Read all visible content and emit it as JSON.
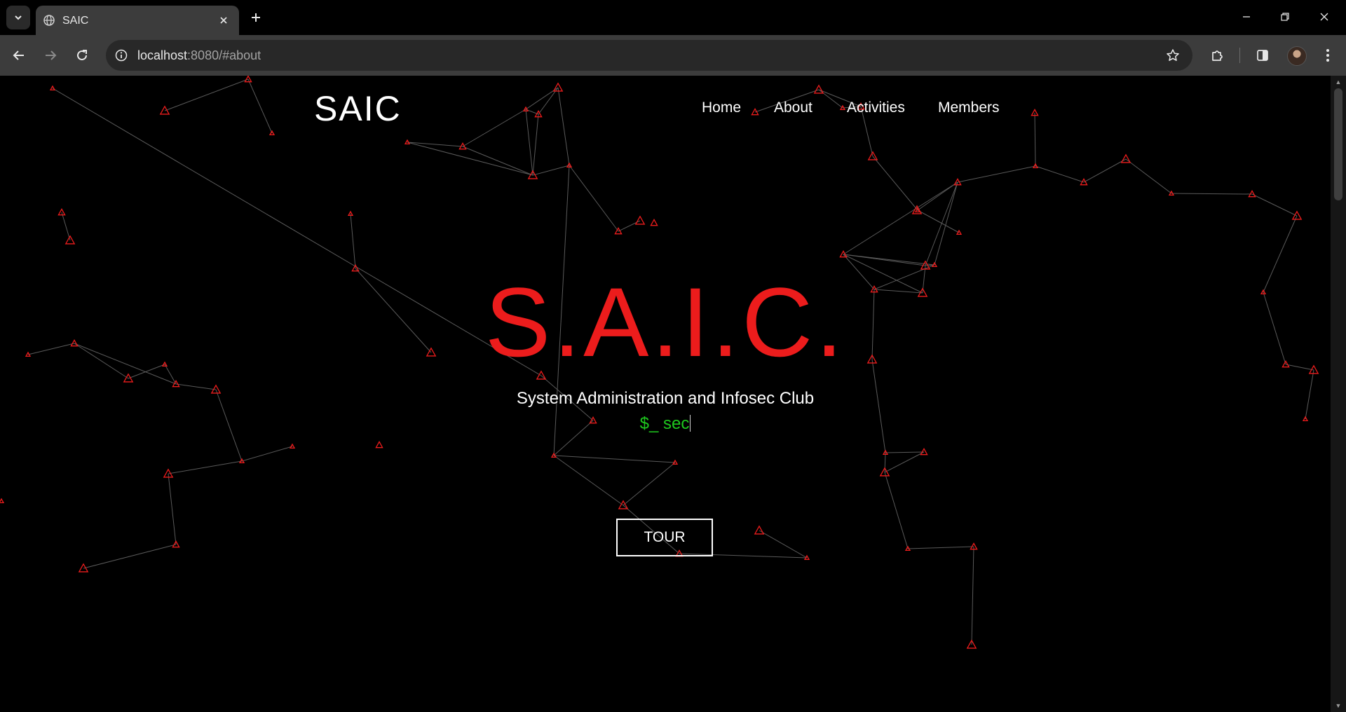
{
  "browser": {
    "tab_title": "SAIC",
    "url_host": "localhost",
    "url_rest": ":8080/#about"
  },
  "site": {
    "brand": "SAIC",
    "nav": [
      {
        "label": "Home"
      },
      {
        "label": "About"
      },
      {
        "label": "Activities"
      },
      {
        "label": "Members"
      }
    ],
    "hero": {
      "title": "S.A.I.C.",
      "subtitle": "System Administration and Infosec Club",
      "typed_text": "$_ sec",
      "cta_label": "TOUR"
    }
  },
  "colors": {
    "accent_red": "#ec1c1c",
    "terminal_green": "#1ec81e",
    "background": "#000000"
  }
}
